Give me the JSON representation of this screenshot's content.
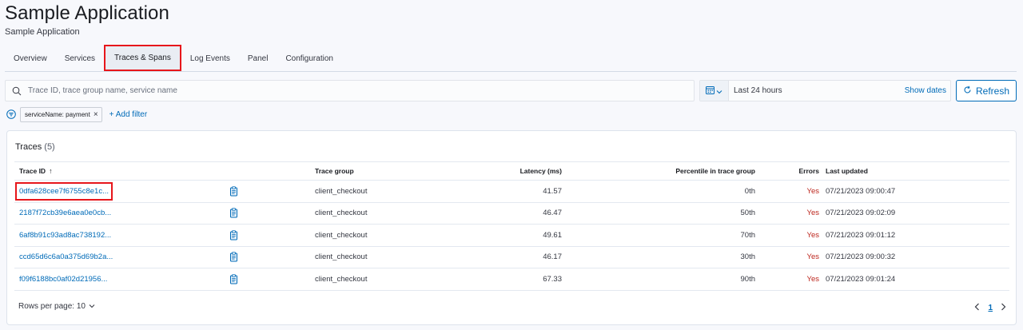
{
  "app": {
    "title": "Sample Application",
    "subtitle": "Sample Application"
  },
  "tabs": [
    {
      "label": "Overview"
    },
    {
      "label": "Services"
    },
    {
      "label": "Traces & Spans",
      "selected": true
    },
    {
      "label": "Log Events"
    },
    {
      "label": "Panel"
    },
    {
      "label": "Configuration"
    }
  ],
  "search": {
    "placeholder": "Trace ID, trace group name, service name",
    "value": ""
  },
  "date_picker": {
    "range": "Last 24 hours",
    "show_dates_label": "Show dates"
  },
  "refresh_label": "Refresh",
  "filters": {
    "pill": "serviceName: payment",
    "add_filter_label": "+ Add filter"
  },
  "traces": {
    "title": "Traces",
    "count": "(5)",
    "columns": {
      "trace_id": "Trace ID",
      "trace_group": "Trace group",
      "latency": "Latency (ms)",
      "percentile": "Percentile in trace group",
      "errors": "Errors",
      "last_updated": "Last updated"
    },
    "sort_indicator": "↑",
    "rows": [
      {
        "trace_id": "0dfa628cee7f6755c8e1c...",
        "trace_group": "client_checkout",
        "latency": "41.57",
        "percentile": "0th",
        "errors": "Yes",
        "last_updated": "07/21/2023 09:00:47"
      },
      {
        "trace_id": "2187f72cb39e6aea0e0cb...",
        "trace_group": "client_checkout",
        "latency": "46.47",
        "percentile": "50th",
        "errors": "Yes",
        "last_updated": "07/21/2023 09:02:09"
      },
      {
        "trace_id": "6af8b91c93ad8ac738192...",
        "trace_group": "client_checkout",
        "latency": "49.61",
        "percentile": "70th",
        "errors": "Yes",
        "last_updated": "07/21/2023 09:01:12"
      },
      {
        "trace_id": "ccd65d6c6a0a375d69b2a...",
        "trace_group": "client_checkout",
        "latency": "46.17",
        "percentile": "30th",
        "errors": "Yes",
        "last_updated": "07/21/2023 09:00:32"
      },
      {
        "trace_id": "f09f6188bc0af02d21956...",
        "trace_group": "client_checkout",
        "latency": "67.33",
        "percentile": "90th",
        "errors": "Yes",
        "last_updated": "07/21/2023 09:01:24"
      }
    ],
    "rows_per_page": "Rows per page: 10",
    "current_page": "1"
  },
  "icons": {
    "search": "search-icon",
    "calendar": "calendar-icon",
    "refresh": "refresh-icon",
    "filter_menu": "filter-menu-icon",
    "copy": "copy-clipboard-icon"
  },
  "colors": {
    "link": "#006bb8",
    "error": "#bd271e",
    "highlight": "#e7161b"
  }
}
